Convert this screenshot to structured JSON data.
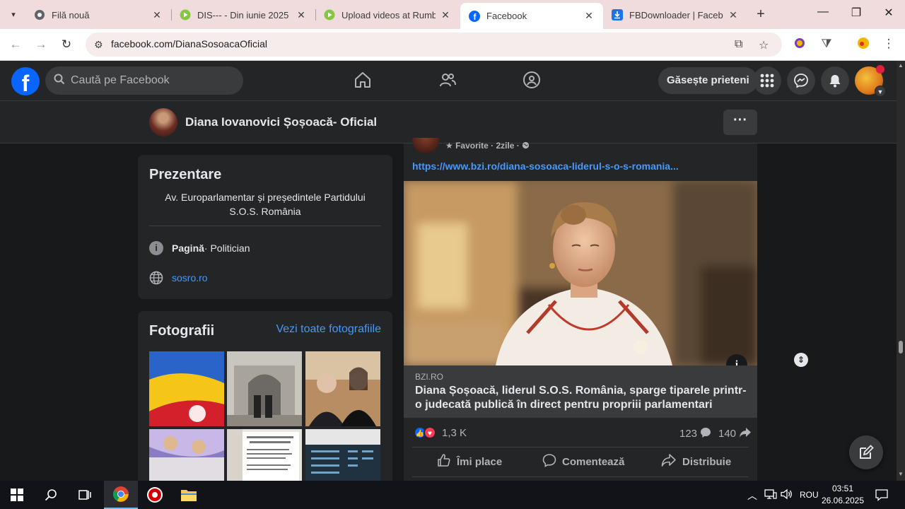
{
  "browser": {
    "tabs": [
      {
        "title": "Filă nouă",
        "favicon": "chrome-icon",
        "active": false
      },
      {
        "title": "DIS--- - Din iunie 2025 -",
        "favicon": "rumble-icon",
        "active": false
      },
      {
        "title": "Upload videos at Rumble",
        "favicon": "rumble-icon",
        "active": false
      },
      {
        "title": "Facebook",
        "favicon": "facebook-icon",
        "active": true
      },
      {
        "title": "FBDownloader | Faceboo",
        "favicon": "download-icon",
        "active": false
      }
    ],
    "url": "facebook.com/DianaSosoacaOficial"
  },
  "fb": {
    "logo": "f",
    "search_placeholder": "Caută pe Facebook",
    "find_friends": "Găsește prieteni"
  },
  "page": {
    "name": "Diana Iovanovici Șoșoacă- Oficial",
    "more": "···"
  },
  "intro": {
    "heading": "Prezentare",
    "text": "Av. Europarlamentar și președintele Partidului S.O.S. România",
    "type_label": "Pagină",
    "type_value": " · Politician",
    "website": "sosro.ro"
  },
  "photos": {
    "heading": "Fotografii",
    "see_all": "Vezi toate fotografiile"
  },
  "post": {
    "meta": "Favorite · 2zile ·",
    "link_url": "https://www.bzi.ro/diana-sosoaca-liderul-s-o-s-romania...",
    "link_domain": "BZI.RO",
    "link_title": "Diana Șoșoacă, liderul S.O.S. România, sparge tiparele printr-o judecată publică în direct pentru propriii parlamentari",
    "reactions_count": "1,3 K",
    "comments_count": "123",
    "shares_count": "140",
    "actions": {
      "like": "Îmi place",
      "comment": "Comentează",
      "share": "Distribuie"
    }
  },
  "taskbar": {
    "language": "ROU",
    "time": "03:51",
    "date": "26.06.2025"
  }
}
